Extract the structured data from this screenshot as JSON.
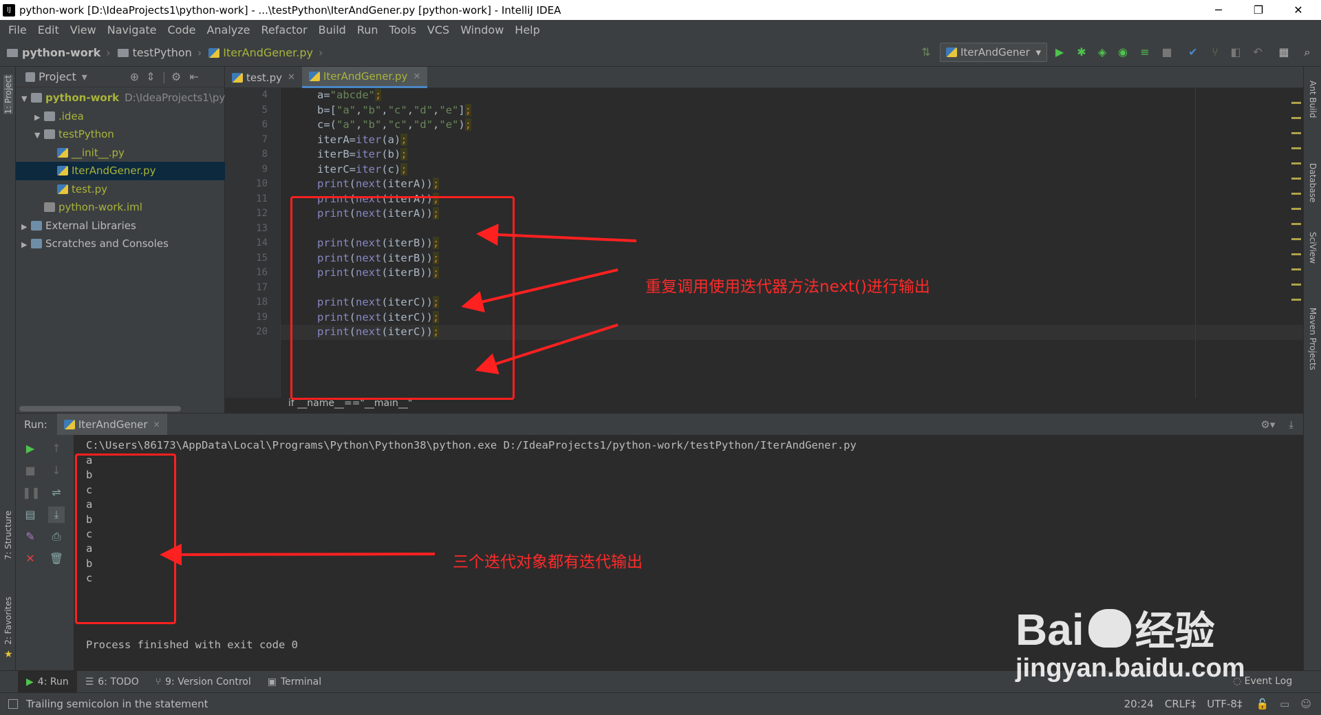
{
  "window": {
    "title": "python-work [D:\\IdeaProjects1\\python-work] - ...\\testPython\\IterAndGener.py [python-work] - IntelliJ IDEA",
    "app_icon": "IJ",
    "controls": [
      "─",
      "❐",
      "✕"
    ]
  },
  "menu": [
    "File",
    "Edit",
    "View",
    "Navigate",
    "Code",
    "Analyze",
    "Refactor",
    "Build",
    "Run",
    "Tools",
    "VCS",
    "Window",
    "Help"
  ],
  "breadcrumbs": [
    "python-work",
    "testPython",
    "IterAndGener.py"
  ],
  "run_config": "IterAndGener",
  "project_panel": {
    "title": "Project",
    "tree": [
      {
        "label": "python-work",
        "extra": "D:\\IdeaProjects1\\py",
        "icon": "folder-icon",
        "level": 0,
        "arrow": "▼"
      },
      {
        "label": ".idea",
        "icon": "folder-icon",
        "level": 1,
        "arrow": "▶"
      },
      {
        "label": "testPython",
        "icon": "folder-icon",
        "level": 1,
        "arrow": "▼"
      },
      {
        "label": "__init__.py",
        "icon": "python-file-icon",
        "level": 2,
        "arrow": ""
      },
      {
        "label": "IterAndGener.py",
        "icon": "python-file-icon",
        "level": 2,
        "arrow": "",
        "selected": true
      },
      {
        "label": "test.py",
        "icon": "python-file-icon",
        "level": 2,
        "arrow": ""
      },
      {
        "label": "python-work.iml",
        "icon": "iml-file-icon",
        "level": 1,
        "arrow": ""
      },
      {
        "label": "External Libraries",
        "icon": "library-icon",
        "level": 0,
        "arrow": "▶"
      },
      {
        "label": "Scratches and Consoles",
        "icon": "scratches-icon",
        "level": 0,
        "arrow": "▶"
      }
    ]
  },
  "editor_tabs": [
    {
      "label": "test.py",
      "active": false
    },
    {
      "label": "IterAndGener.py",
      "active": true
    }
  ],
  "code_lines": [
    {
      "n": "4",
      "text": "a=\"abcde\";"
    },
    {
      "n": "5",
      "text": "b=[\"a\",\"b\",\"c\",\"d\",\"e\"];"
    },
    {
      "n": "6",
      "text": "c=(\"a\",\"b\",\"c\",\"d\",\"e\");"
    },
    {
      "n": "7",
      "text": "iterA=iter(a);"
    },
    {
      "n": "8",
      "text": "iterB=iter(b);"
    },
    {
      "n": "9",
      "text": "iterC=iter(c);"
    },
    {
      "n": "10",
      "text": "print(next(iterA));"
    },
    {
      "n": "11",
      "text": "print(next(iterA));"
    },
    {
      "n": "12",
      "text": "print(next(iterA));"
    },
    {
      "n": "13",
      "text": ""
    },
    {
      "n": "14",
      "text": "print(next(iterB));"
    },
    {
      "n": "15",
      "text": "print(next(iterB));"
    },
    {
      "n": "16",
      "text": "print(next(iterB));"
    },
    {
      "n": "17",
      "text": ""
    },
    {
      "n": "18",
      "text": "print(next(iterC));"
    },
    {
      "n": "19",
      "text": "print(next(iterC));"
    },
    {
      "n": "20",
      "text": "print(next(iterC));"
    }
  ],
  "editor_breadcrumb": "if __name__==\"__main__\"",
  "run_panel": {
    "label": "Run:",
    "tab": "IterAndGener",
    "command": "C:\\Users\\86173\\AppData\\Local\\Programs\\Python\\Python38\\python.exe D:/IdeaProjects1/python-work/testPython/IterAndGener.py",
    "output": [
      "a",
      "b",
      "c",
      "a",
      "b",
      "c",
      "a",
      "b",
      "c"
    ],
    "finish": "Process finished with exit code 0"
  },
  "left_tool_windows": [
    "1: Project",
    "7: Structure",
    "2: Favorites"
  ],
  "right_tool_windows": [
    "Ant Build",
    "Database",
    "SciView",
    "Maven Projects"
  ],
  "bottom_tabs": [
    {
      "label": "4: Run",
      "icon": "▶",
      "active": true
    },
    {
      "label": "6: TODO",
      "icon": "☰",
      "active": false
    },
    {
      "label": "9: Version Control",
      "icon": "⑂",
      "active": false
    },
    {
      "label": "Terminal",
      "icon": "▣",
      "active": false
    }
  ],
  "event_log": "Event Log",
  "status": {
    "message": "Trailing semicolon in the statement",
    "position": "20:24",
    "line_sep": "CRLF‡",
    "encoding": "UTF-8‡"
  },
  "annotations": {
    "code_note": "重复调用使用迭代器方法next()进行输出",
    "output_note": "三个迭代对象都有迭代输出"
  },
  "watermark": {
    "brand": "Bai",
    "brand_cn": "经验",
    "url": "jingyan.baidu.com"
  },
  "colors": {
    "accent_red": "#ff2020",
    "keyword": "#8888c6",
    "string": "#6a8759",
    "run_green": "#4ec34e"
  }
}
